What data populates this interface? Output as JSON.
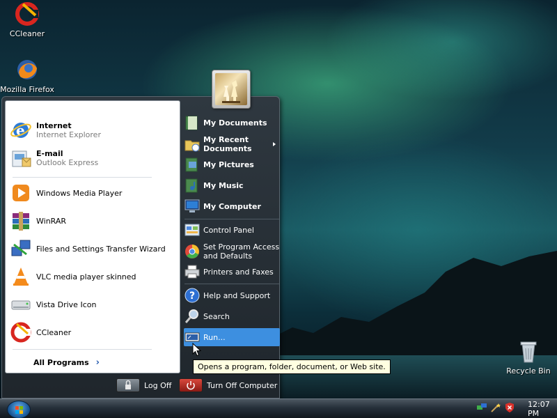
{
  "desktop": {
    "icons": [
      {
        "label": "CCleaner",
        "icon": "ccleaner-icon"
      },
      {
        "label": "Mozilla Firefox",
        "icon": "firefox-icon"
      },
      {
        "label": "Recycle Bin",
        "icon": "recycle-bin-icon"
      }
    ]
  },
  "start_menu": {
    "pinned": [
      {
        "title": "Internet",
        "subtitle": "Internet Explorer",
        "icon": "internet-explorer-icon"
      },
      {
        "title": "E-mail",
        "subtitle": "Outlook Express",
        "icon": "outlook-express-icon"
      }
    ],
    "recent": [
      {
        "label": "Windows Media Player",
        "icon": "media-player-icon"
      },
      {
        "label": "WinRAR",
        "icon": "winrar-icon"
      },
      {
        "label": "Files and Settings Transfer Wizard",
        "icon": "transfer-wizard-icon"
      },
      {
        "label": "VLC media player skinned",
        "icon": "vlc-icon"
      },
      {
        "label": "Vista Drive Icon",
        "icon": "drive-icon"
      },
      {
        "label": "CCleaner",
        "icon": "ccleaner-icon"
      }
    ],
    "all_programs": "All Programs",
    "right": {
      "my_documents": "My Documents",
      "my_recent_documents": "My Recent Documents",
      "my_pictures": "My Pictures",
      "my_music": "My Music",
      "my_computer": "My Computer",
      "control_panel": "Control Panel",
      "set_program_access": "Set Program Access and Defaults",
      "printers_and_faxes": "Printers and Faxes",
      "help_and_support": "Help and Support",
      "search": "Search",
      "run": "Run..."
    },
    "log_off": "Log Off",
    "turn_off": "Turn Off Computer",
    "tooltip": "Opens a program, folder, document, or Web site."
  },
  "taskbar": {
    "clock": "12:07 PM"
  },
  "colors": {
    "highlight": "#3d8fe0",
    "menu_bg": "#2a3239",
    "tooltip_bg": "#ffffe1"
  }
}
